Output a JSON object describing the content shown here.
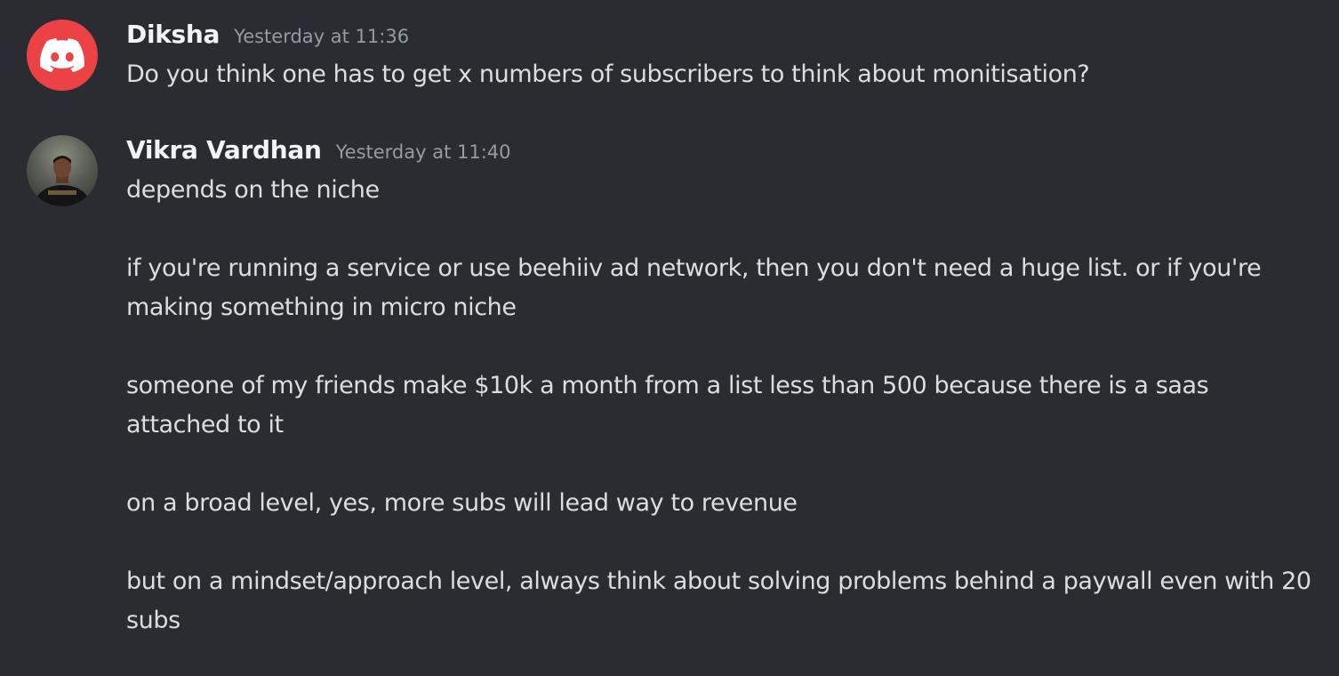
{
  "messages": [
    {
      "author": "Diksha",
      "timestamp": "Yesterday at 11:36",
      "avatar": "discord-logo",
      "avatar_color": "#ed4245",
      "paragraphs": [
        "Do you think one has to get x numbers of subscribers to think about monitisation?"
      ]
    },
    {
      "author": "Vikra Vardhan",
      "timestamp": "Yesterday at 11:40",
      "avatar": "user-photo",
      "paragraphs": [
        "depends on the niche",
        "if you're running a service or use beehiiv ad network, then you don't need a huge list. or if you're making something in micro niche",
        "someone of my friends make $10k a month from a list less than 500 because there is a saas attached to it",
        "on a broad level, yes, more subs will lead way to revenue",
        "but on a mindset/approach level, always think about solving problems behind a paywall even with 20 subs"
      ]
    }
  ],
  "colors": {
    "background": "#2b2c31",
    "username": "#f2f3f5",
    "timestamp": "#949ba4",
    "message_text": "#dbdee1"
  }
}
